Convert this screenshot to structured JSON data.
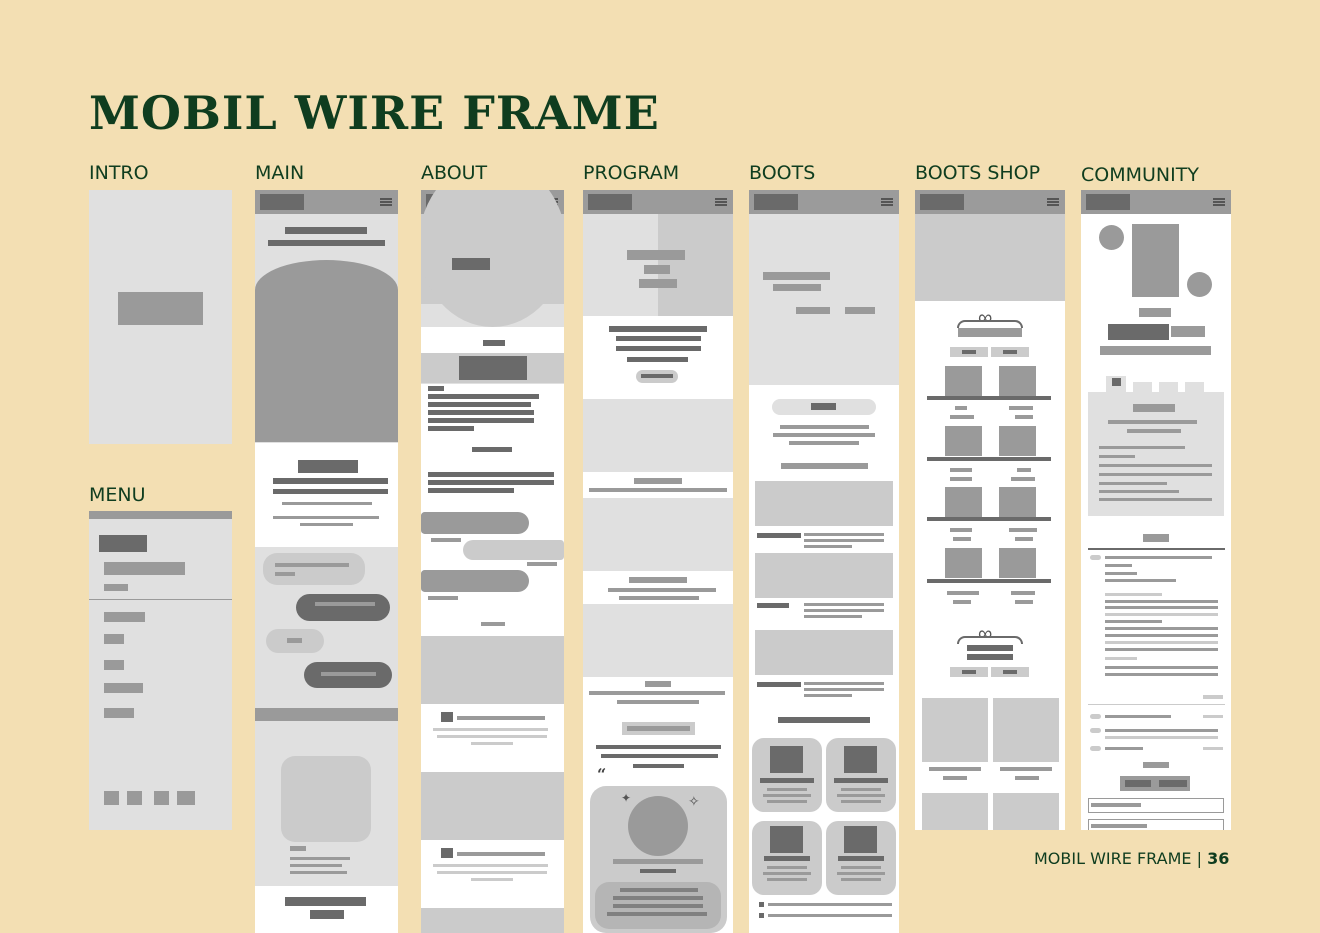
{
  "title": "MOBIL WIRE FRAME",
  "frames": {
    "intro": "INTRO",
    "menu": "MENU",
    "main": "MAIN",
    "about": "ABOUT",
    "program": "PROGRAM",
    "boots": "BOOTS",
    "boots_shop": "BOOTS SHOP",
    "community": "COMMUNITY"
  },
  "footer": {
    "text": "MOBIL WIRE FRAME",
    "separator": "|",
    "page": "36"
  },
  "colors": {
    "background": "#f3dfb3",
    "title": "#0f3d1f",
    "wire_dark": "#6a6a6a",
    "wire_mid": "#9a9a9a",
    "wire_light": "#e0e0e0"
  },
  "icons": [
    "hamburger-menu-icon",
    "quote-icon",
    "sparkle-icon",
    "bow-icon"
  ]
}
